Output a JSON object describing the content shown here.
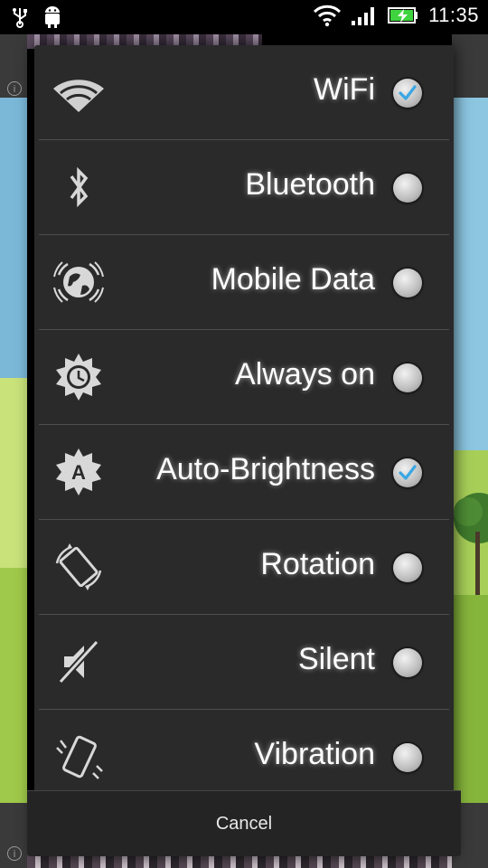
{
  "status_bar": {
    "time": "11:35",
    "icons": [
      "usb-icon",
      "android-debug-icon",
      "wifi-signal-icon",
      "cell-signal-icon",
      "battery-charging-icon"
    ]
  },
  "dialog": {
    "items": [
      {
        "icon": "wifi-icon",
        "label": "WiFi",
        "checked": true
      },
      {
        "icon": "bluetooth-icon",
        "label": "Bluetooth",
        "checked": false
      },
      {
        "icon": "mobile-data-icon",
        "label": "Mobile Data",
        "checked": false
      },
      {
        "icon": "always-on-icon",
        "label": "Always on",
        "checked": false
      },
      {
        "icon": "auto-brightness-icon",
        "label": "Auto-Brightness",
        "checked": true
      },
      {
        "icon": "rotation-icon",
        "label": "Rotation",
        "checked": false
      },
      {
        "icon": "silent-icon",
        "label": "Silent",
        "checked": false
      },
      {
        "icon": "vibration-icon",
        "label": "Vibration",
        "checked": false
      }
    ],
    "cancel_label": "Cancel"
  },
  "colors": {
    "dialog_bg": "#2a2a2a",
    "check_accent": "#3aa7e4",
    "text": "#ffffff"
  }
}
